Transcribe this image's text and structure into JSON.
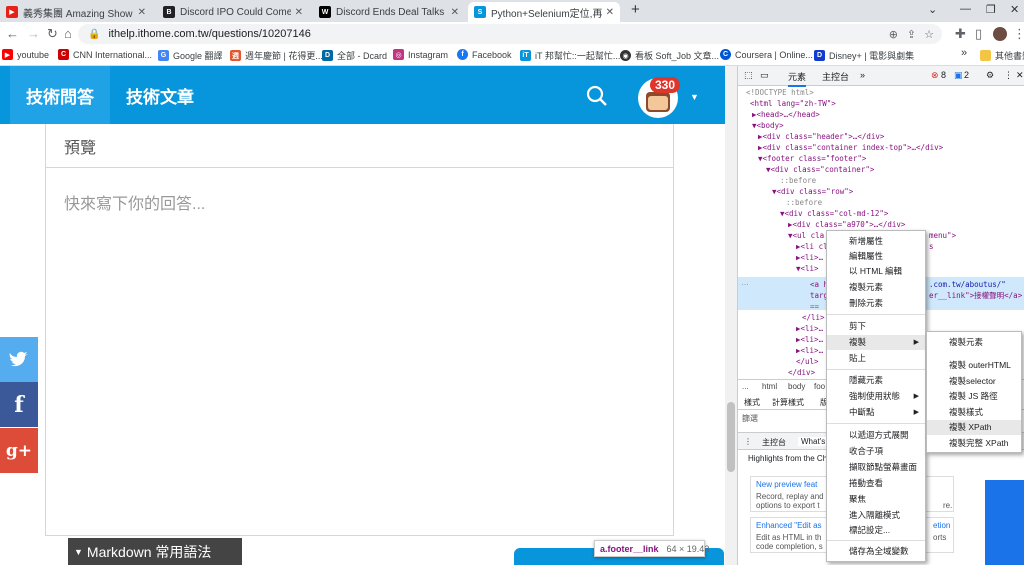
{
  "tabs": [
    {
      "title": "義秀集團 Amazing Show - 推薦",
      "favicon_color": "#e62117"
    },
    {
      "title": "Discord IPO Could Come in Ea",
      "favicon_color": "#202124"
    },
    {
      "title": "Discord Ends Deal Talks With M",
      "favicon_color": "#000000"
    },
    {
      "title": "Python+Selenium定位,再用個",
      "favicon_color": "#0795db"
    }
  ],
  "new_tab": "+",
  "url": "ithelp.ithome.com.tw/questions/10207146",
  "bookmarks": [
    {
      "label": "youtube",
      "color": "#ff0000"
    },
    {
      "label": "CNN International...",
      "color": "#cc0000"
    },
    {
      "label": "Google 翻譯",
      "color": "#4285f4"
    },
    {
      "label": "週年慶節 | 花得更...",
      "color": "#e4572e"
    },
    {
      "label": "全部 - Dcard",
      "color": "#006aa6"
    },
    {
      "label": "Instagram",
      "color": "#c13584"
    },
    {
      "label": "Facebook",
      "color": "#1877f2"
    },
    {
      "label": "iT 邦幫忙::一起幫忙...",
      "color": "#0795db"
    },
    {
      "label": "看板 Soft_Job 文章...",
      "color": "#333333"
    },
    {
      "label": "Coursera | Online...",
      "color": "#0056d2"
    },
    {
      "label": "Disney+ | 電影與劇集",
      "color": "#113ccf"
    },
    {
      "label": "其他書籤",
      "color": "#f4c542"
    }
  ],
  "site": {
    "nav_tabs": [
      "技術問答",
      "技術文章"
    ],
    "notification_count": "330",
    "preview_label": "預覽",
    "answer_placeholder": "快來寫下你的回答...",
    "markdown_label": "Markdown 常用語法",
    "social": [
      "twitter",
      "facebook",
      "google-plus"
    ],
    "accent": "#0795db"
  },
  "tooltip": {
    "selector": "a.footer__link",
    "size": "64 × 19.43"
  },
  "devtools": {
    "tabs": [
      "元素",
      "主控台",
      "»"
    ],
    "error_count": "8",
    "message_count": "2",
    "code_lines": [
      "<!DOCTYPE html>",
      "<html lang=\"zh-TW\">",
      "▶<head>…</head>",
      "▼<body>",
      "▶<div class=\"header\">…</div>",
      "▶<div class=\"container index-top\">…</div>",
      "▼<footer class=\"footer\">",
      "▼<div class=\"container\">",
      "::before",
      "▼<div class=\"row\">",
      "::before",
      "▼<div class=\"col-md-12\">",
      "▶<div class=\"a970\">…</div>",
      "▼<ul cla",
      "▶<li cl",
      "▶<li>…",
      "▼<li>",
      "<a h",
      "targ",
      "== ",
      "</li>",
      "▶<li>…",
      "▶<li>…",
      "▶<li>…",
      "</ul>",
      "</div>"
    ],
    "highlight_tail": [
      ".com.tw/aboutus/\"",
      "er__link\">接權聲明</a>"
    ],
    "menu_tail": "menu\">",
    "li_tail": "s",
    "breadcrumbs": [
      "...",
      "html",
      "body",
      "foo"
    ],
    "styles_tabs": [
      "樣式",
      "計算樣式",
      "版"
    ],
    "filter_label": "篩選",
    "drawer_tabs": [
      "主控台",
      "What's"
    ],
    "whats_new_heading": "Highlights from the Ch",
    "cards": [
      {
        "title": "New preview feat",
        "line1": "Record, replay and",
        "line2": "options to export t"
      },
      {
        "title": "Enhanced \"Edit as",
        "line1": "Edit as HTML in th",
        "line2": "code completion, s"
      }
    ],
    "card_tails": [
      "re.",
      "etion",
      "orts"
    ]
  },
  "context_menu": {
    "items": [
      {
        "label": "新增屬性"
      },
      {
        "label": "編輯屬性"
      },
      {
        "label": "以 HTML 編輯"
      },
      {
        "label": "複製元素"
      },
      {
        "label": "刪除元素"
      },
      {
        "label": "剪下"
      },
      {
        "label": "複製",
        "submenu": true
      },
      {
        "label": "貼上"
      },
      {
        "label": "隱藏元素"
      },
      {
        "label": "強制使用狀態",
        "submenu": true
      },
      {
        "label": "中斷點",
        "submenu": true
      },
      {
        "label": "以遞迴方式展開"
      },
      {
        "label": "收合子項"
      },
      {
        "label": "擷取節點螢幕畫面"
      },
      {
        "label": "捲動查看"
      },
      {
        "label": "聚焦"
      },
      {
        "label": "進入隔離模式"
      },
      {
        "label": "標記設定..."
      },
      {
        "label": "儲存為全域變數"
      }
    ]
  },
  "copy_submenu": {
    "items": [
      "複製元素",
      "複製 outerHTML",
      "複製selector",
      "複製 JS 路徑",
      "複製樣式",
      "複製 XPath",
      "複製完整 XPath"
    ],
    "highlighted": "複製 XPath"
  }
}
